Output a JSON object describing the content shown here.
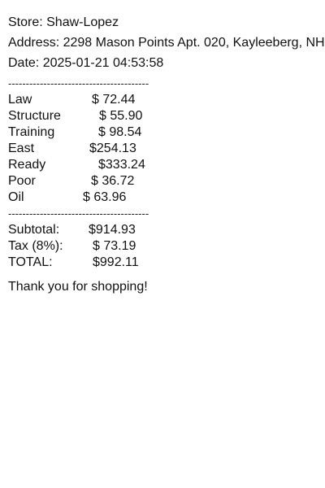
{
  "header": {
    "store": "Store: Shaw-Lopez",
    "address": "Address: 2298 Mason Points Apt. 020, Kayleeberg, NH",
    "date": "Date: 2025-01-21 04:53:58"
  },
  "divider": "----------------------------------------",
  "items": [
    {
      "name": "Law",
      "price": "$ 72.44"
    },
    {
      "name": "Structure",
      "price": "$ 55.90"
    },
    {
      "name": "Training",
      "price": "$ 98.54"
    },
    {
      "name": "East",
      "price": "$254.13"
    },
    {
      "name": "Ready",
      "price": "$333.24"
    },
    {
      "name": "Poor",
      "price": "$ 36.72"
    },
    {
      "name": "Oil",
      "price": "$ 63.96"
    }
  ],
  "totals": {
    "subtotal_label": "Subtotal:",
    "subtotal_value": "$914.93",
    "tax_label": "Tax (8%):",
    "tax_value": "$ 73.19",
    "total_label": "TOTAL:",
    "total_value": "$992.11"
  },
  "footer": {
    "thanks": "Thank you for shopping!"
  }
}
